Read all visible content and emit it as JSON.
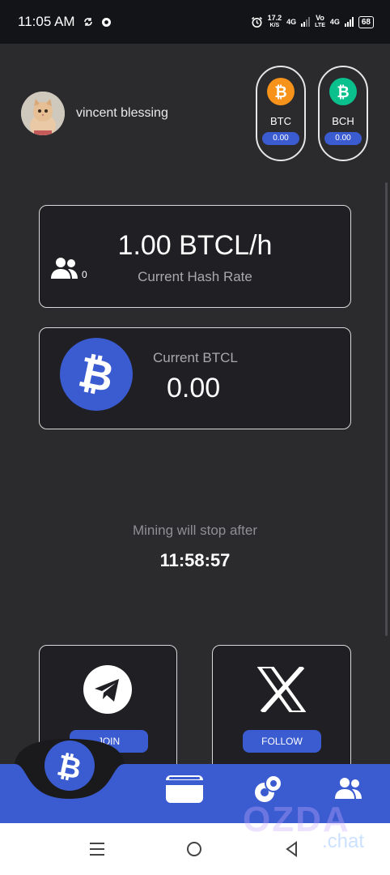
{
  "status_bar": {
    "time": "11:05 AM",
    "net_speed_value": "17.2",
    "net_speed_unit": "K/S",
    "network_1": "4G",
    "network_vo": "Vo",
    "network_lte": "LTE",
    "network_2": "4G",
    "battery": "68"
  },
  "profile": {
    "username": "vincent blessing"
  },
  "coins": [
    {
      "symbol": "BTC",
      "value": "0.00",
      "color": "#f7931a"
    },
    {
      "symbol": "BCH",
      "value": "0.00",
      "color": "#0ac18e"
    }
  ],
  "hash_card": {
    "rate": "1.00 BTCL/h",
    "label": "Current Hash Rate",
    "referral_count": "0"
  },
  "balance_card": {
    "label": "Current BTCL",
    "value": "0.00"
  },
  "mining": {
    "message": "Mining will stop after",
    "timer": "11:58:57"
  },
  "social": {
    "telegram_button": "JOIN",
    "x_button": "FOLLOW"
  },
  "watermark": {
    "brand": "OZDA",
    "suffix": ".chat"
  },
  "colors": {
    "accent": "#3b5bd1",
    "background": "#2b2b2e",
    "card": "#1f1f24"
  },
  "icons": {
    "bottom_nav": [
      "bitcoin-icon",
      "wallet-icon",
      "coins-icon",
      "team-icon"
    ],
    "system_nav": [
      "recents-icon",
      "home-icon",
      "back-icon"
    ]
  }
}
